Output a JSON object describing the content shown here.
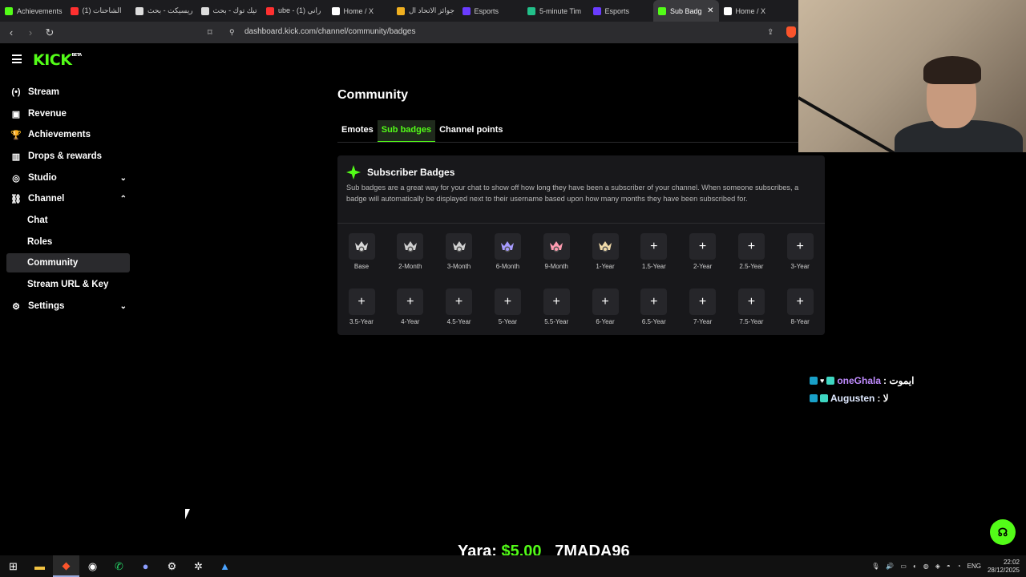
{
  "browser": {
    "tabs": [
      {
        "label": "Achievements",
        "color": "#53fc18",
        "active": false
      },
      {
        "label": "(1) الشاحنات",
        "color": "#ff3030",
        "active": false
      },
      {
        "label": "ريسيكت - بحث",
        "color": "#dddddd",
        "active": false
      },
      {
        "label": "تيك توك - بحث",
        "color": "#dddddd",
        "active": false
      },
      {
        "label": "ube - (1) راني",
        "color": "#ff3030",
        "active": false
      },
      {
        "label": "Home / X",
        "color": "#ffffff",
        "active": false
      },
      {
        "label": "جوائز الاتحاد ال",
        "color": "#f0b020",
        "active": false
      },
      {
        "label": "Esports",
        "color": "#6a3cff",
        "active": false
      },
      {
        "label": "5-minute Tim",
        "color": "#22c08a",
        "active": false
      },
      {
        "label": "Esports",
        "color": "#6a3cff",
        "active": false
      },
      {
        "label": "Sub Badg",
        "color": "#53fc18",
        "active": true
      },
      {
        "label": "Home / X",
        "color": "#ffffff",
        "active": false
      }
    ],
    "url": "dashboard.kick.com/channel/community/badges"
  },
  "brand": {
    "logo": "KICK",
    "beta": "BETA"
  },
  "sidebar": {
    "items": [
      {
        "label": "Stream",
        "icon": "(•)"
      },
      {
        "label": "Revenue",
        "icon": "▣"
      },
      {
        "label": "Achievements",
        "icon": "🏆"
      },
      {
        "label": "Drops & rewards",
        "icon": "▥"
      },
      {
        "label": "Studio",
        "icon": "◎",
        "chev": "⌄"
      },
      {
        "label": "Channel",
        "icon": "⛓",
        "chev": "⌃"
      },
      {
        "label": "Chat"
      },
      {
        "label": "Roles"
      },
      {
        "label": "Community",
        "active": true
      },
      {
        "label": "Stream URL & Key"
      },
      {
        "label": "Settings",
        "icon": "⚙",
        "chev": "⌄"
      }
    ]
  },
  "main": {
    "title": "Community",
    "tabs": [
      "Emotes",
      "Sub badges",
      "Channel points"
    ],
    "active_tab": "Sub badges",
    "panel": {
      "title": "Subscriber Badges",
      "description": "Sub badges are a great way for your chat to show off how long they have been a subscriber of your channel. When someone subscribes, a badge will automatically be displayed next to their username based upon how many months they have been subscribed for.",
      "badges": [
        {
          "label": "Base",
          "icon": "sub-badge-base-icon",
          "color": "#d8d8d8"
        },
        {
          "label": "2-Month",
          "icon": "sub-badge-2month-icon",
          "color": "#cfcfcf"
        },
        {
          "label": "3-Month",
          "icon": "sub-badge-3month-icon",
          "color": "#d0d0d0"
        },
        {
          "label": "6-Month",
          "icon": "sub-badge-6month-icon",
          "color": "#a79bff"
        },
        {
          "label": "9-Month",
          "icon": "sub-badge-9month-icon",
          "color": "#ff9bb0"
        },
        {
          "label": "1-Year",
          "icon": "sub-badge-1year-icon",
          "color": "#f0d9a8"
        },
        {
          "label": "1.5-Year",
          "icon": "plus-icon"
        },
        {
          "label": "2-Year",
          "icon": "plus-icon"
        },
        {
          "label": "2.5-Year",
          "icon": "plus-icon"
        },
        {
          "label": "3-Year",
          "icon": "plus-icon"
        },
        {
          "label": "3.5-Year",
          "icon": "plus-icon"
        },
        {
          "label": "4-Year",
          "icon": "plus-icon"
        },
        {
          "label": "4.5-Year",
          "icon": "plus-icon"
        },
        {
          "label": "5-Year",
          "icon": "plus-icon"
        },
        {
          "label": "5.5-Year",
          "icon": "plus-icon"
        },
        {
          "label": "6-Year",
          "icon": "plus-icon"
        },
        {
          "label": "6.5-Year",
          "icon": "plus-icon"
        },
        {
          "label": "7-Year",
          "icon": "plus-icon"
        },
        {
          "label": "7.5-Year",
          "icon": "plus-icon"
        },
        {
          "label": "8-Year",
          "icon": "plus-icon"
        }
      ]
    }
  },
  "overlay": {
    "chat": [
      {
        "name": "oneGhala",
        "message": ": ايموت"
      },
      {
        "name": "Augusten",
        "message": ": لا"
      }
    ],
    "donation": {
      "name": "Yara:",
      "amount": "$5.00",
      "next": "7MADA96"
    }
  },
  "taskbar": {
    "lang": "ENG",
    "time": "22:02",
    "date": "28/12/2025"
  },
  "colors": {
    "accent": "#53fc18",
    "panel": "#18181b",
    "background": "#000000"
  }
}
